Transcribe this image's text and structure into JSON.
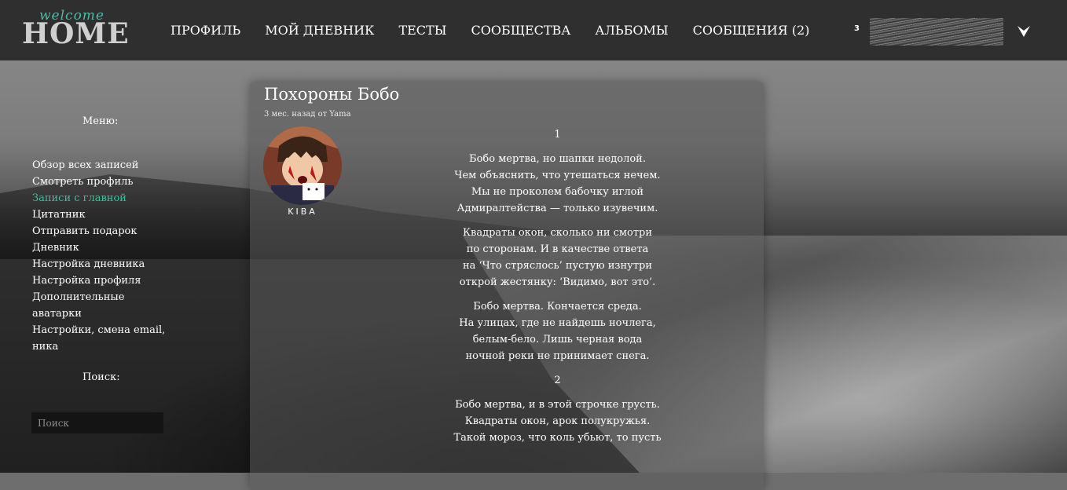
{
  "header": {
    "logo_small": "welcome",
    "logo_big": "HOME",
    "nav": [
      "ПРОФИЛЬ",
      "МОЙ ДНЕВНИК",
      "ТЕСТЫ",
      "СООБЩЕСТВА",
      "АЛЬБОМЫ",
      "СООБЩЕНИЯ (2)"
    ],
    "user_count": "3",
    "menu_icon": "chevron-down-icon"
  },
  "sidebar": {
    "menu_title": "Меню:",
    "items": [
      {
        "label": "Обзор всех записей",
        "active": false
      },
      {
        "label": "Смотреть профиль",
        "active": false
      },
      {
        "label": "Записи с главной",
        "active": true
      },
      {
        "label": "Цитатник",
        "active": false
      },
      {
        "label": "Отправить подарок",
        "active": false
      },
      {
        "label": "Дневник",
        "active": false
      },
      {
        "label": "Настройка дневника",
        "active": false
      },
      {
        "label": "Настройка профиля",
        "active": false
      },
      {
        "label": "Дополнительные аватарки",
        "active": false
      },
      {
        "label": "Настройки, смена email, ника",
        "active": false
      }
    ],
    "search_title": "Поиск:",
    "search_placeholder": "Поиск",
    "active_color": "#33c59c"
  },
  "post": {
    "title": "Похороны Бобо",
    "meta": "3 мес. назад от Yama",
    "author": "KIBA",
    "sections": [
      {
        "number": "1",
        "stanzas": [
          [
            "Бобо мертва, но шапки недолой.",
            "Чем объяснить, что утешаться нечем.",
            "Мы не проколем бабочку иглой",
            "Адмиралтейства — только изувечим."
          ],
          [
            "Квадраты окон, сколько ни смотри",
            "по сторонам. И в качестве ответа",
            "на ‘Что стряслось’ пустую изнутри",
            "открой жестянку: ‘Видимо, вот это’."
          ],
          [
            "Бобо мертва. Кончается среда.",
            "На улицах, где не найдешь ночлега,",
            "белым-бело. Лишь черная вода",
            "ночной реки не принимает снега."
          ]
        ]
      },
      {
        "number": "2",
        "stanzas": [
          [
            "Бобо мертва, и в этой строчке грусть.",
            "Квадраты окон, арок полукружья.",
            "Такой мороз, что коль убьют, то пусть"
          ]
        ]
      }
    ]
  }
}
